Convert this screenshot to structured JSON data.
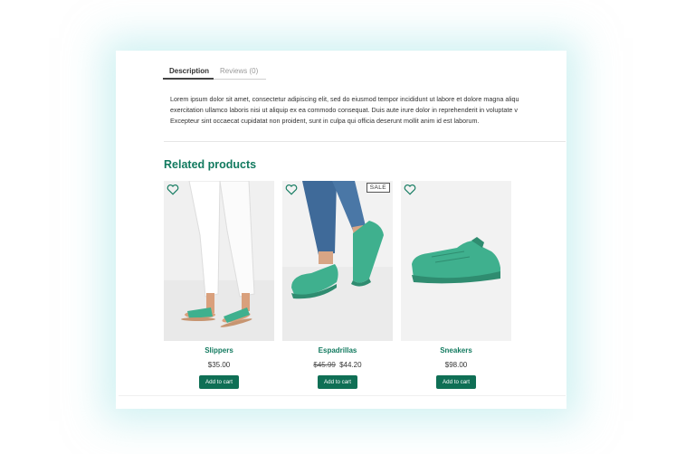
{
  "tabs": {
    "description": "Description",
    "reviews": "Reviews (0)"
  },
  "description": {
    "line1": "Lorem ipsum dolor sit amet, consectetur adipiscing elit, sed do eiusmod tempor incididunt ut labore et dolore magna aliqu",
    "line2": "exercitation ullamco laboris nisi ut aliquip ex ea commodo consequat. Duis aute irure dolor in reprehenderit in voluptate v",
    "line3": "Excepteur sint occaecat cupidatat non proident, sunt in culpa qui officia deserunt mollit anim id est laborum."
  },
  "related": {
    "title": "Related products",
    "products": [
      {
        "name": "Slippers",
        "price": "$35.00",
        "old_price": "",
        "add_label": "Add to cart"
      },
      {
        "name": "Espadrillas",
        "price": "$44.20",
        "old_price": "$45.99",
        "sale": "SALE",
        "add_label": "Add to cart"
      },
      {
        "name": "Sneakers",
        "price": "$98.00",
        "old_price": "",
        "add_label": "Add to cart"
      }
    ]
  },
  "colors": {
    "accent": "#127a5f",
    "button": "#0f6f55",
    "shoe": "#3fb08e"
  }
}
